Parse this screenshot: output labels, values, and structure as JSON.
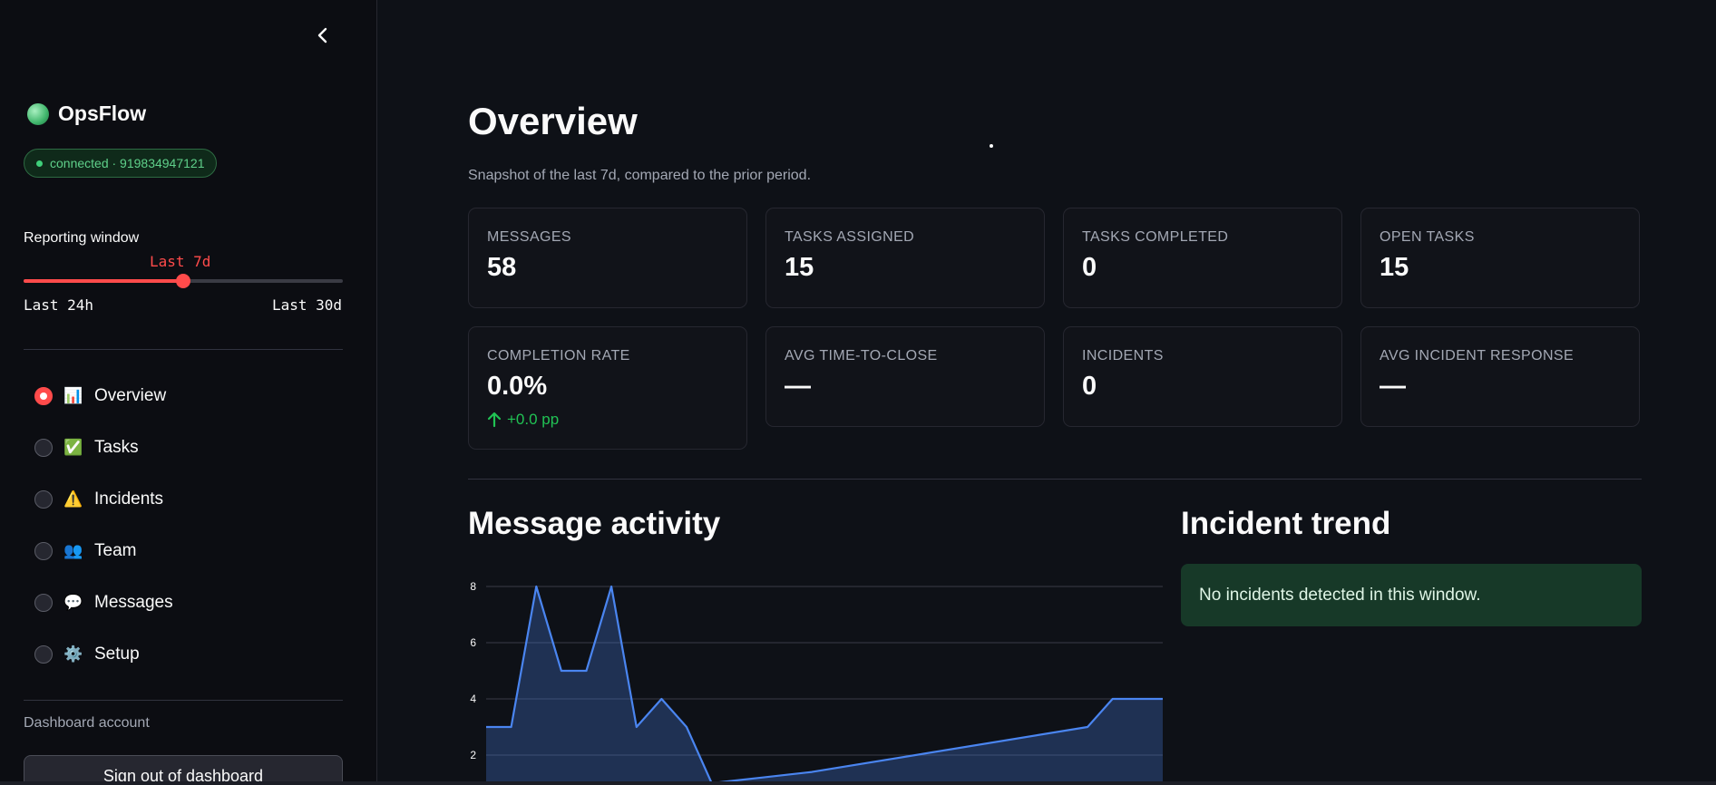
{
  "sidebar": {
    "brand": {
      "name": "OpsFlow"
    },
    "connection_badge": "connected · 919834947121",
    "reporting_window": {
      "label": "Reporting window",
      "value": "Last 7d",
      "min_label": "Last 24h",
      "max_label": "Last 30d",
      "position_fraction": 0.5
    },
    "nav": {
      "selected_index": 0,
      "items": [
        {
          "icon": "📊",
          "label": "Overview"
        },
        {
          "icon": "✅",
          "label": "Tasks"
        },
        {
          "icon": "⚠️",
          "label": "Incidents"
        },
        {
          "icon": "👥",
          "label": "Team"
        },
        {
          "icon": "💬",
          "label": "Messages"
        },
        {
          "icon": "⚙️",
          "label": "Setup"
        }
      ]
    },
    "account_label": "Dashboard account",
    "signout_label": "Sign out of dashboard"
  },
  "main": {
    "title": "Overview",
    "caption": "Snapshot of the last 7d, compared to the prior period.",
    "metrics": [
      {
        "label": "MESSAGES",
        "value": "58"
      },
      {
        "label": "TASKS ASSIGNED",
        "value": "15"
      },
      {
        "label": "TASKS COMPLETED",
        "value": "0"
      },
      {
        "label": "OPEN TASKS",
        "value": "15"
      },
      {
        "label": "COMPLETION RATE",
        "value": "0.0%",
        "delta": "+0.0 pp"
      },
      {
        "label": "AVG TIME-TO-CLOSE",
        "value": "—"
      },
      {
        "label": "INCIDENTS",
        "value": "0"
      },
      {
        "label": "AVG INCIDENT RESPONSE",
        "value": "—"
      }
    ],
    "message_activity": {
      "title": "Message activity"
    },
    "incident_trend": {
      "title": "Incident trend",
      "empty_message": "No incidents detected in this window."
    }
  },
  "colors": {
    "accent": "#ff4b4b",
    "success": "#21c354",
    "series": "#4a85f0"
  },
  "chart_data": {
    "type": "area",
    "title": "Message activity",
    "x": [
      0,
      1,
      2,
      3,
      4,
      5,
      6,
      7,
      8,
      9,
      10,
      11,
      12,
      13,
      24,
      25,
      26,
      27
    ],
    "series": [
      {
        "values": [
          3,
          3,
          8,
          5,
          5,
          8,
          3,
          4,
          3,
          1,
          1.1,
          1.2,
          1.3,
          1.4,
          3,
          4,
          4,
          4
        ]
      }
    ],
    "yticks": [
      2,
      4,
      6,
      8
    ],
    "ylim": [
      0,
      8.5
    ],
    "grid": true
  }
}
